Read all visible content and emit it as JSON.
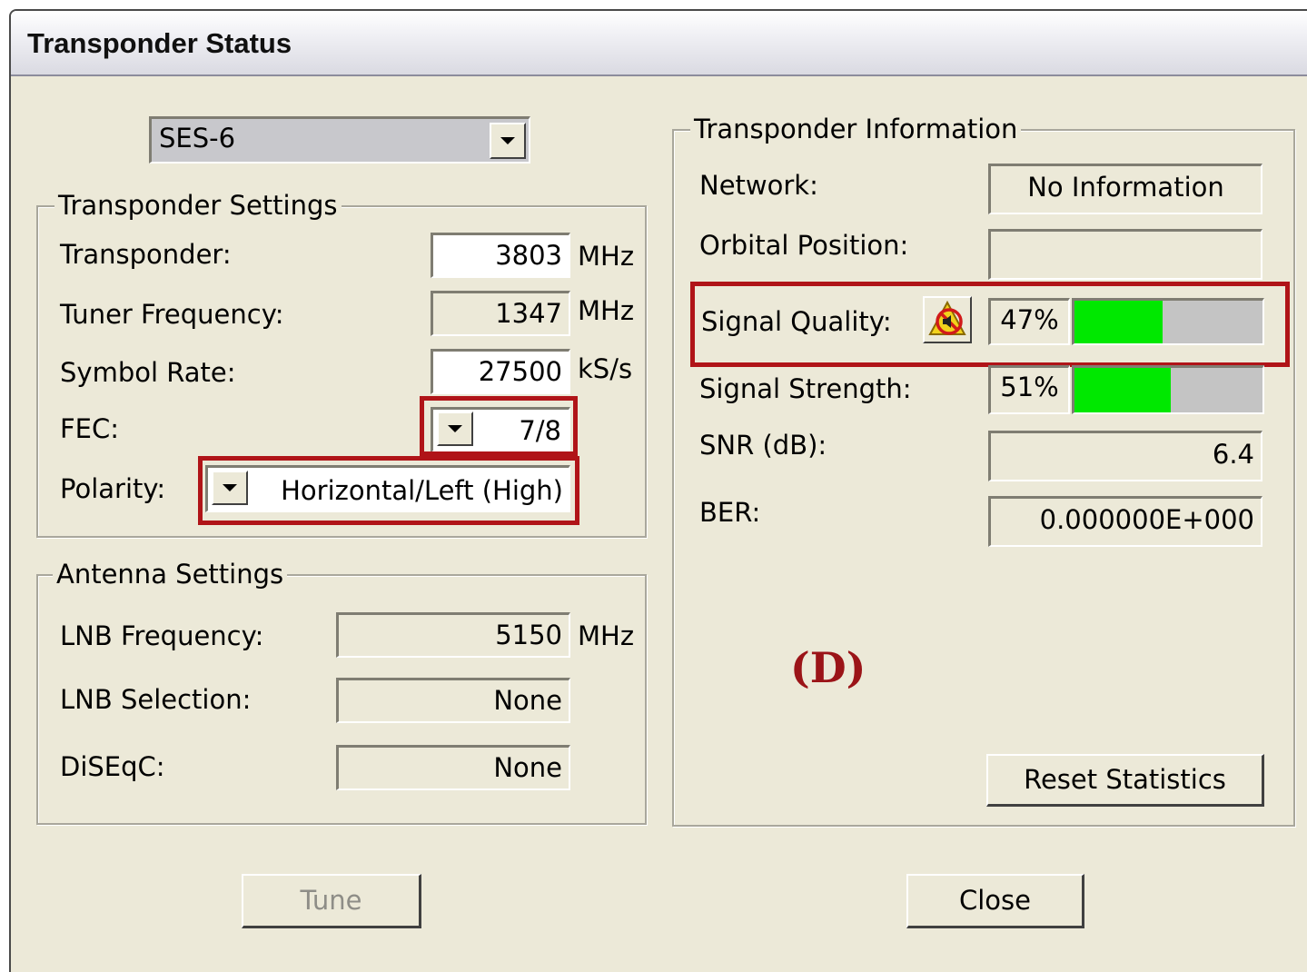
{
  "window": {
    "title": "Transponder Status"
  },
  "satellite_select": {
    "value": "SES-6"
  },
  "transponder_settings": {
    "legend": "Transponder Settings",
    "transponder": {
      "label": "Transponder:",
      "value": "3803",
      "unit": "MHz"
    },
    "tuner_frequency": {
      "label": "Tuner Frequency:",
      "value": "1347",
      "unit": "MHz"
    },
    "symbol_rate": {
      "label": "Symbol Rate:",
      "value": "27500",
      "unit": "kS/s"
    },
    "fec": {
      "label": "FEC:",
      "value": "7/8"
    },
    "polarity": {
      "label": "Polarity:",
      "value": "Horizontal/Left (High)"
    }
  },
  "antenna_settings": {
    "legend": "Antenna Settings",
    "lnb_frequency": {
      "label": "LNB Frequency:",
      "value": "5150",
      "unit": "MHz"
    },
    "lnb_selection": {
      "label": "LNB Selection:",
      "value": "None"
    },
    "diseqc": {
      "label": "DiSEqC:",
      "value": "None"
    }
  },
  "transponder_information": {
    "legend": "Transponder Information",
    "network": {
      "label": "Network:",
      "value": "No Information"
    },
    "orbital_position": {
      "label": "Orbital Position:",
      "value": ""
    },
    "signal_quality": {
      "label": "Signal Quality:",
      "value": "47%",
      "level": 0.47,
      "icon": "audio-alert-icon"
    },
    "signal_strength": {
      "label": "Signal Strength:",
      "value": "51%",
      "level": 0.51
    },
    "snr": {
      "label": "SNR (dB):",
      "value": "6.4"
    },
    "ber": {
      "label": "BER:",
      "value": "0.000000E+000"
    },
    "reset_button": "Reset Statistics"
  },
  "annotation": "(D)",
  "buttons": {
    "tune": "Tune",
    "close": "Close"
  },
  "colors": {
    "highlight_box": "#b01418",
    "annotation_text": "#9b1418",
    "bar_fill": "#00e800",
    "bar_empty": "#c4c4c4",
    "window_bg": "#ece9d8"
  }
}
